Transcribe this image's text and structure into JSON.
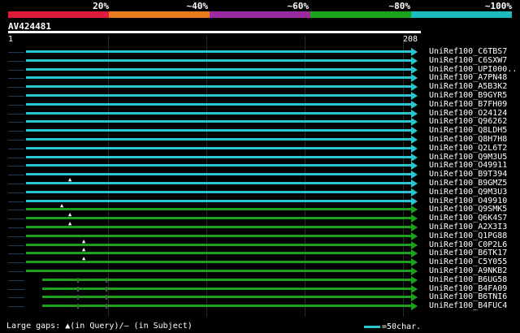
{
  "legend": {
    "colors": [
      "#e01a3c",
      "#e87a1e",
      "#9b2aa0",
      "#1aa31a",
      "#1dbbc0"
    ],
    "labels": [
      "20%",
      "~40%",
      "~60%",
      "~80%",
      "~100%"
    ]
  },
  "query": {
    "id": "AV424481",
    "start": "1",
    "end": "208"
  },
  "hits": [
    {
      "name": "UniRef100_C6TBS7",
      "color": "cyan"
    },
    {
      "name": "UniRef100_C6SXW7",
      "color": "cyan"
    },
    {
      "name": "UniRef100_UPI000..",
      "color": "cyan"
    },
    {
      "name": "UniRef100_A7PN48",
      "color": "cyan"
    },
    {
      "name": "UniRef100_A5B3K2",
      "color": "cyan"
    },
    {
      "name": "UniRef100_B9GYR5",
      "color": "cyan"
    },
    {
      "name": "UniRef100_B7FH09",
      "color": "cyan"
    },
    {
      "name": "UniRef100_O24124",
      "color": "cyan"
    },
    {
      "name": "UniRef100_Q96262",
      "color": "cyan"
    },
    {
      "name": "UniRef100_Q8LDH5",
      "color": "cyan"
    },
    {
      "name": "UniRef100_Q8H7H8",
      "color": "cyan"
    },
    {
      "name": "UniRef100_Q2L6T2",
      "color": "cyan"
    },
    {
      "name": "UniRef100_Q9M3U5",
      "color": "cyan"
    },
    {
      "name": "UniRef100_O49911",
      "color": "cyan"
    },
    {
      "name": "UniRef100_B9T394",
      "color": "cyan"
    },
    {
      "name": "UniRef100_B9GMZ5",
      "color": "cyan"
    },
    {
      "name": "UniRef100_Q9M3U3",
      "color": "cyan"
    },
    {
      "name": "UniRef100_O49910",
      "color": "cyan"
    },
    {
      "name": "UniRef100_Q9SMK5",
      "color": "green"
    },
    {
      "name": "UniRef100_Q6K4S7",
      "color": "green"
    },
    {
      "name": "UniRef100_A2X3I3",
      "color": "green"
    },
    {
      "name": "UniRef100_Q1PG88",
      "color": "green"
    },
    {
      "name": "UniRef100_C0P2L6",
      "color": "green"
    },
    {
      "name": "UniRef100_B6TK17",
      "color": "green"
    },
    {
      "name": "UniRef100_C5Y055",
      "color": "green"
    },
    {
      "name": "UniRef100_A9NKB2",
      "color": "green"
    },
    {
      "name": "UniRef100_B6UG58",
      "color": "green"
    },
    {
      "name": "UniRef100_B4FA09",
      "color": "green"
    },
    {
      "name": "UniRef100_B6TNI6",
      "color": "green"
    },
    {
      "name": "UniRef100_B4FUC4",
      "color": "green"
    }
  ],
  "footer": {
    "text": "Large gaps: ▲(in Query)/– (in Subject)"
  },
  "scale": {
    "text": "=50char."
  },
  "colors": {
    "cyan": "#27c6d0",
    "green": "#1aa31a"
  }
}
